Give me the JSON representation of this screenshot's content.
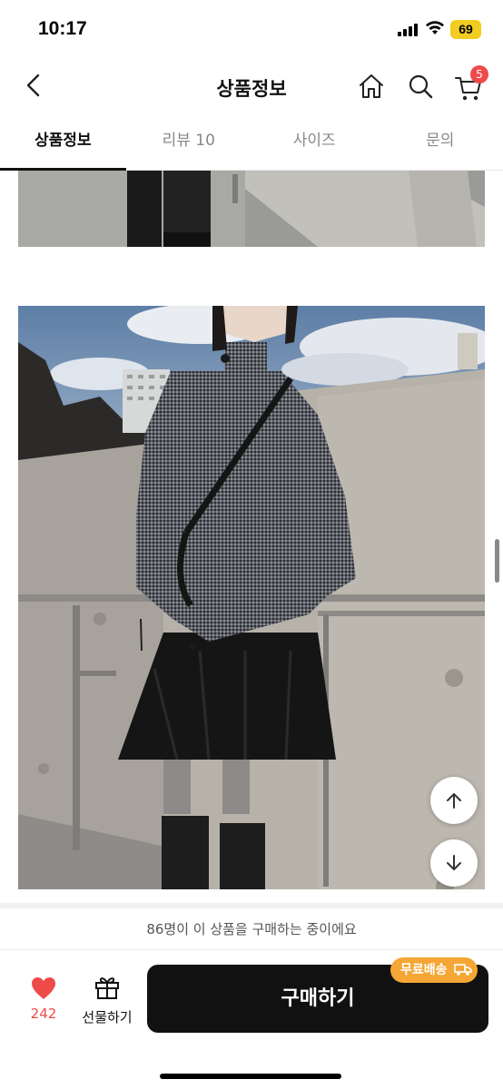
{
  "status_bar": {
    "time": "10:17",
    "battery": "69"
  },
  "header": {
    "title": "상품정보",
    "back_icon": "chevron-left-icon",
    "home_icon": "home-icon",
    "search_icon": "search-icon",
    "cart_icon": "cart-icon",
    "cart_count": "5",
    "cart_badge_color": "#ef4a4a"
  },
  "tabs": [
    {
      "label": "상품정보",
      "active": true
    },
    {
      "label": "리뷰 10",
      "active": false
    },
    {
      "label": "사이즈",
      "active": false
    },
    {
      "label": "문의",
      "active": false
    }
  ],
  "scroll_buttons": {
    "up_icon": "arrow-up-icon",
    "down_icon": "arrow-down-icon"
  },
  "purchase_notice": "86명이 이 상품을 구매하는 중이에요",
  "bottom_bar": {
    "like_icon": "heart-icon",
    "like_count": "242",
    "gift_icon": "gift-icon",
    "gift_label": "선물하기",
    "buy_label": "구매하기",
    "free_shipping_badge": "무료배송",
    "accent_color": "#ef4a4a",
    "badge_color": "#f5a634"
  }
}
